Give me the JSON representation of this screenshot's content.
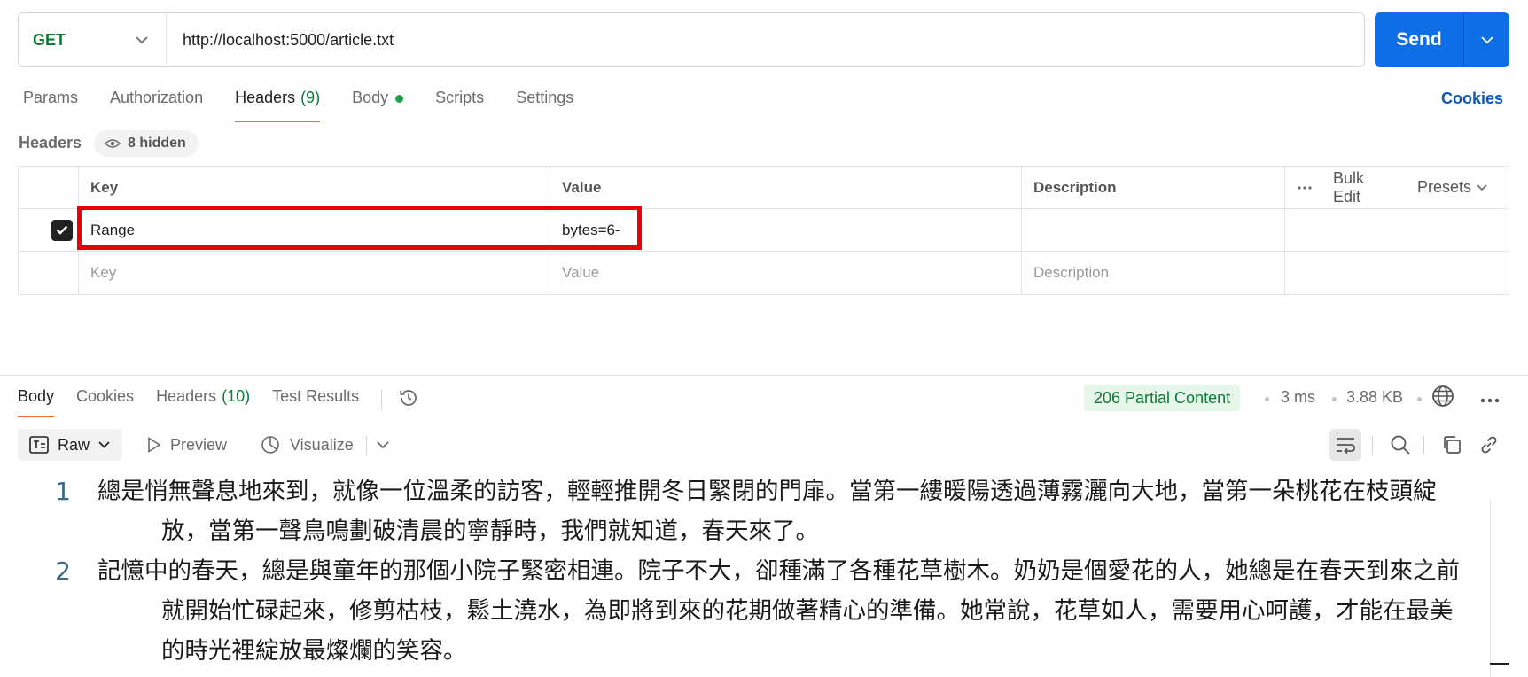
{
  "request": {
    "method": "GET",
    "url": "http://localhost:5000/article.txt",
    "send_label": "Send"
  },
  "request_tabs": [
    {
      "label": "Params"
    },
    {
      "label": "Authorization"
    },
    {
      "label": "Headers",
      "count": "(9)",
      "active": true
    },
    {
      "label": "Body",
      "has_dot": true
    },
    {
      "label": "Scripts"
    },
    {
      "label": "Settings"
    }
  ],
  "cookies_link": "Cookies",
  "headers_section": {
    "label": "Headers",
    "hidden_chip": "8 hidden",
    "columns": {
      "key": "Key",
      "value": "Value",
      "description": "Description"
    },
    "actions": {
      "bulk_edit": "Bulk Edit",
      "presets": "Presets"
    },
    "rows": [
      {
        "checked": true,
        "key": "Range",
        "value": "bytes=6-",
        "description": ""
      }
    ],
    "placeholders": {
      "key": "Key",
      "value": "Value",
      "description": "Description"
    }
  },
  "response": {
    "tabs": [
      {
        "label": "Body",
        "active": true
      },
      {
        "label": "Cookies"
      },
      {
        "label": "Headers",
        "count": "(10)"
      },
      {
        "label": "Test Results"
      }
    ],
    "status": "206 Partial Content",
    "time": "3 ms",
    "size": "3.88 KB",
    "view_mode": "Raw",
    "preview_label": "Preview",
    "visualize_label": "Visualize",
    "lines": [
      {
        "num": "1",
        "text": "總是悄無聲息地來到，就像一位溫柔的訪客，輕輕推開冬日緊閉的門扉。當第一縷暖陽透過薄霧灑向大地，當第一朵桃花在枝頭綻放，當第一聲鳥鳴劃破清晨的寧靜時，我們就知道，春天來了。"
      },
      {
        "num": "2",
        "text": "記憶中的春天，總是與童年的那個小院子緊密相連。院子不大，卻種滿了各種花草樹木。奶奶是個愛花的人，她總是在春天到來之前就開始忙碌起來，修剪枯枝，鬆土澆水，為即將到來的花期做著精心的準備。她常說，花草如人，需要用心呵護，才能在最美的時光裡綻放最燦爛的笑容。"
      }
    ]
  },
  "colors": {
    "accent": "#0d6ee6",
    "method": "#0c7b35",
    "tab_underline": "#f26b3a",
    "highlight_box": "#e8000b",
    "status_bg": "#e6f6ea"
  }
}
